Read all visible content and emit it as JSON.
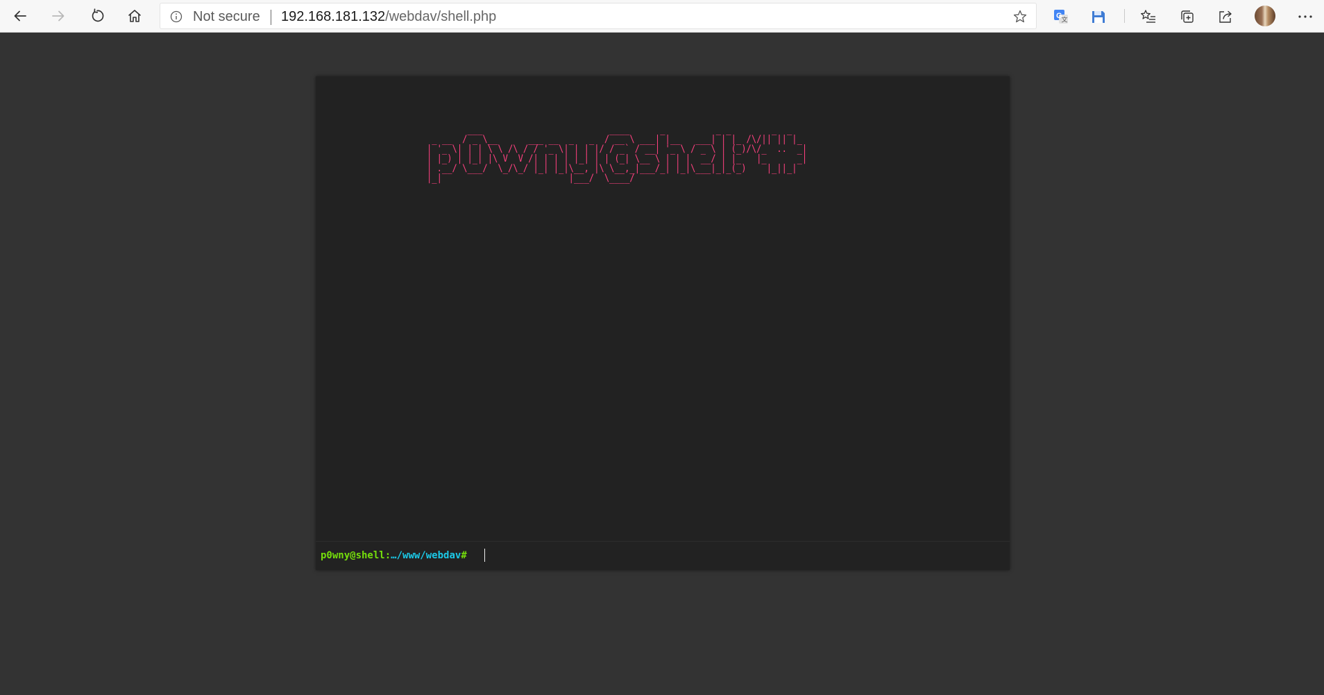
{
  "browser": {
    "security_label": "Not secure",
    "url_host": "192.168.181.132",
    "url_path": "/webdav/shell.php"
  },
  "shell": {
    "banner_art": "        ___                         ____      _          _ _        _  _   \n _ __  / _ \\__      ___ __  _   _  / __ \\ ___| |__   ___| | |_ /\\/|| || |_ \n| '_ \\| | | \\ \\ /\\ / / '_ \\| | | |/ / _` / __| '_ \\ / _ \\ | (_)/\\/_  ..  _|\n| |_) | |_| |\\ V  V /| | | | |_| | | (_| \\__ \\ | | |  __/ | |_   |_      _|\n| .__/ \\___/  \\_/\\_/ |_| |_|\\__, |\\ \\__,_|___/_| |_|\\___|_|_(_)    |_||_|  \n|_|                         |___/  \\____/                                 ",
    "prompt_user": "p0wny@shell",
    "prompt_sep": ":",
    "prompt_path": "…/www/webdav",
    "prompt_symbol": "#",
    "input_value": ""
  },
  "colors": {
    "banner": "#ff4180",
    "prompt_user": "#75df0b",
    "prompt_path": "#1bc9e7",
    "page_bg": "#333333",
    "shell_bg": "#222222"
  }
}
